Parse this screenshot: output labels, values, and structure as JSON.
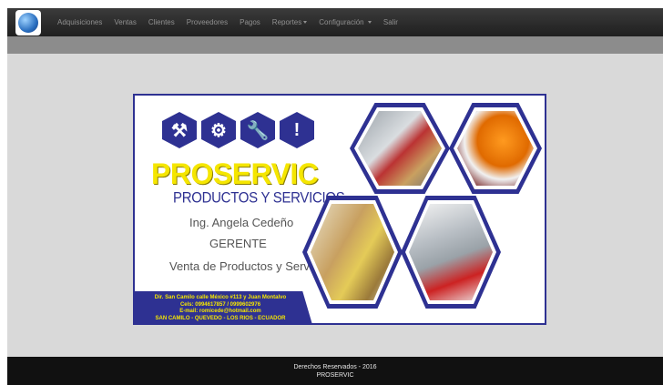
{
  "nav": {
    "items": [
      {
        "label": "Adquisiciones",
        "dropdown": false
      },
      {
        "label": "Ventas",
        "dropdown": false
      },
      {
        "label": "Clientes",
        "dropdown": false
      },
      {
        "label": "Proveedores",
        "dropdown": false
      },
      {
        "label": "Pagos",
        "dropdown": false
      },
      {
        "label": "Reportes",
        "dropdown": true
      },
      {
        "label": "Configuración",
        "dropdown": true
      },
      {
        "label": "Salir",
        "dropdown": false
      }
    ]
  },
  "banner": {
    "brand": "PROSERVIC",
    "subtitle": "PRODUCTOS Y SERVICIOS",
    "person": "Ing. Angela Cedeño",
    "role": "GERENTE",
    "activity": "Venta de Productos y Servicios",
    "address_lines": [
      "Dir. San Camilo calle México #113 y Juan Montalvo",
      "Cels: 0994617857 / 0999602976",
      "E-mail: romicede@hotmail.com",
      "SAN CAMILO - QUEVEDO - LOS RIOS - ECUADOR"
    ],
    "tool_icons": [
      "hammer-icon",
      "wrench-icon",
      "spanner-icon",
      "screwdriver-icon"
    ],
    "photo_icons": [
      "tools-photo",
      "hardhat-photo",
      "gloves-tape-photo",
      "pipes-photo"
    ],
    "colors": {
      "primary": "#2e3192",
      "accent": "#f5e600"
    }
  },
  "footer": {
    "line1": "Derechos Reservados - 2016",
    "line2": "PROSERVIC"
  }
}
